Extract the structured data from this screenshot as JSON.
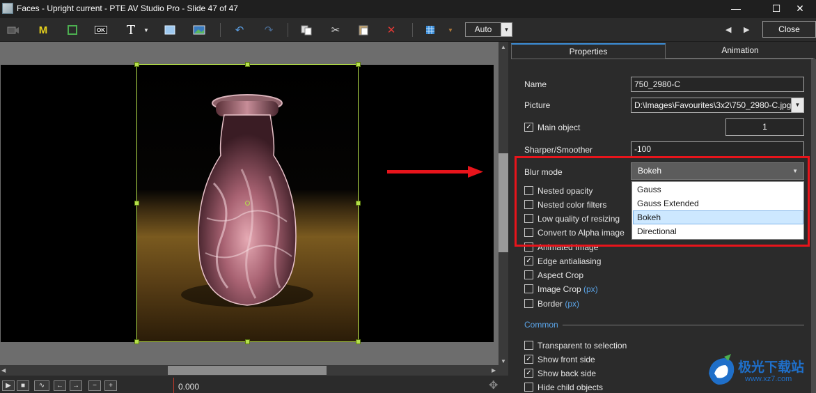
{
  "window": {
    "title": "Faces - Upright current - PTE AV Studio Pro - Slide 47 of 47",
    "minimize": "—",
    "maximize": "☐",
    "close": "✕"
  },
  "toolbar": {
    "m_label": "M",
    "ok_label": "OK",
    "text_label": "T",
    "auto_value": "Auto",
    "close_label": "Close",
    "prev_arrow": "◀",
    "next_arrow": "▶"
  },
  "timeline": {
    "time": "0.000"
  },
  "tabs": {
    "properties": "Properties",
    "animation": "Animation"
  },
  "props": {
    "name_label": "Name",
    "name_value": "750_2980-C",
    "picture_label": "Picture",
    "picture_value": "D:\\Images\\Favourites\\3x2\\750_2980-C.jpg",
    "main_object_label": "Main object",
    "main_object_checked": true,
    "main_object_value": "1",
    "sharper_label": "Sharper/Smoother",
    "sharper_value": "-100",
    "blur_label": "Blur mode",
    "blur_value": "Bokeh",
    "blur_options": [
      "Gauss",
      "Gauss Extended",
      "Bokeh",
      "Directional"
    ],
    "checkboxes": [
      {
        "label": "Nested opacity",
        "checked": false
      },
      {
        "label": "Nested color filters",
        "checked": false
      },
      {
        "label": "Low quality of resizing",
        "checked": false
      },
      {
        "label": "Convert to Alpha image",
        "checked": false
      },
      {
        "label": "Animated Image",
        "checked": false
      },
      {
        "label": "Edge antialiasing",
        "checked": true
      },
      {
        "label": "Aspect Crop",
        "checked": false
      },
      {
        "label": "Image Crop",
        "checked": false,
        "suffix": "(px)"
      },
      {
        "label": "Border",
        "checked": false,
        "suffix": "(px)"
      }
    ],
    "common_label": "Common",
    "common_checkboxes": [
      {
        "label": "Transparent to selection",
        "checked": false
      },
      {
        "label": "Show front side",
        "checked": true
      },
      {
        "label": "Show back side",
        "checked": true
      },
      {
        "label": "Hide child objects",
        "checked": false
      }
    ]
  },
  "watermark": {
    "text": "极光下载站",
    "url": "www.xz7.com"
  },
  "colors": {
    "accent_blue": "#3c8ed8",
    "selection_green": "#b5e04a",
    "highlight_red": "#e8141b"
  }
}
